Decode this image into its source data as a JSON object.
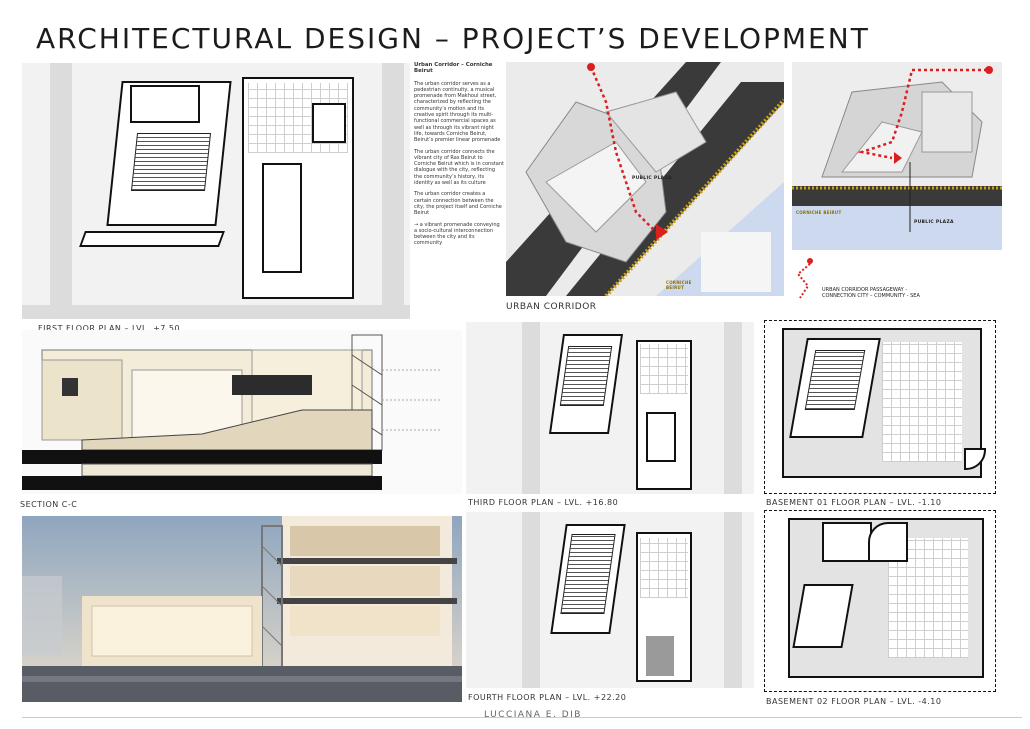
{
  "page": {
    "title": "ARCHITECTURAL DESIGN – PROJECT’S DEVELOPMENT",
    "author": "LUCCIANA E. DIB"
  },
  "captions": {
    "first_floor": "FIRST FLOOR PLAN – LVL. +7.50",
    "urban_corridor": "URBAN CORRIDOR",
    "section": "SECTION C-C",
    "third_floor": "THIRD FLOOR PLAN – LVL. +16.80",
    "basement_01": "BASEMENT 01 FLOOR PLAN – LVL. -1.10",
    "fourth_floor": "FOURTH FLOOR PLAN – LVL. +22.20",
    "basement_02": "BASEMENT 02 FLOOR PLAN – LVL. -4.10"
  },
  "text_block": {
    "heading": "Urban Corridor – Corniche Beirut",
    "p1": "The urban corridor serves as a pedestrian continuity, a musical promenade from Makhoul street, characterized by reflecting the community’s motion and its creative spirit through its multi-functional commercial spaces as well as through its vibrant night life, towards Corniche Beirut, Beirut’s premier linear promenade",
    "p2": "The urban corridor connects the vibrant city of Ras Beirut to Corniche Beirut which is in constant dialogue with the city, reflecting the community’s history, its identity as well as its culture",
    "p3": "The urban corridor creates a certain connection between the city, the project itself and Corniche Beirut",
    "p4": "→ a vibrant promenade conveying a socio-cultural interconnection between the city and its community"
  },
  "aerial": {
    "public_plaza_1": "PUBLIC PLAZA",
    "public_plaza_2": "PUBLIC PLAZA",
    "corniche_1": "CORNICHE BEIRUT",
    "corniche_2": "CORNICHE BEIRUT"
  },
  "legend": {
    "line1": "URBAN CORRIDOR PASSAGEWAY -",
    "line2": "CONNECTION CITY – COMMUNITY - SEA"
  },
  "colors": {
    "path_red": "#d9201f",
    "corniche_yellow": "#c9a21a",
    "road_dark": "#3a3a3a",
    "sea_blue": "#cdd9ee"
  }
}
